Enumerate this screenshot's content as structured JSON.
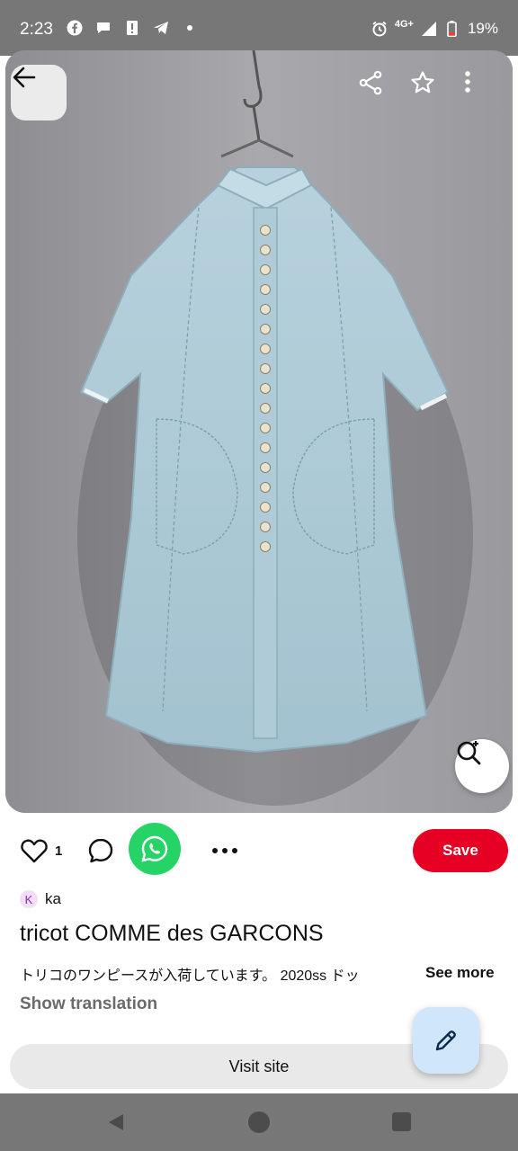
{
  "status_bar": {
    "time": "2:23",
    "network": "4G+",
    "battery": "19%",
    "icons": [
      "facebook-icon",
      "chat-icon",
      "alert-icon",
      "telegram-icon",
      "dot-icon",
      "alarm-icon",
      "signal-icon",
      "battery-icon"
    ]
  },
  "hero": {
    "image_subject": "light blue denim button-front dress on hanger",
    "actions": [
      "back-arrow-icon",
      "share-icon",
      "star-icon",
      "more-vertical-icon",
      "visual-search-icon"
    ]
  },
  "actions": {
    "like_count": "1",
    "save_label": "Save"
  },
  "creator": {
    "initial": "K",
    "name": "ka"
  },
  "pin": {
    "title": "tricot COMME des GARCONS",
    "description": "トリコのワンピースが入荷しています。 2020ss ドッ",
    "see_more": "See more",
    "show_translation": "Show translation"
  },
  "visit_site_label": "Visit site",
  "colors": {
    "save": "#e60023",
    "whatsapp": "#25d366",
    "fab": "#cfe6fb",
    "system_bars": "#777777"
  }
}
